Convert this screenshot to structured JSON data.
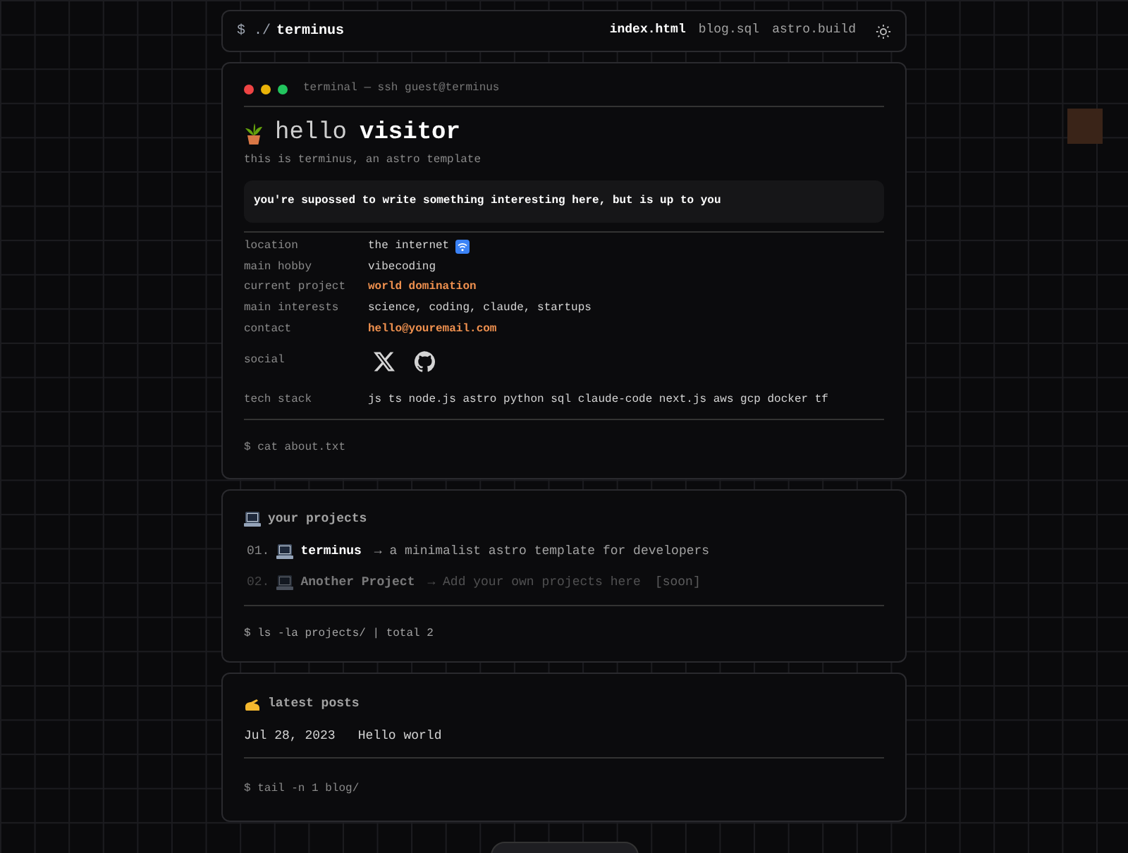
{
  "header": {
    "prompt": "$ ./",
    "title": "terminus",
    "nav": [
      {
        "label": "index.html",
        "selected": true
      },
      {
        "label": "blog.sql",
        "selected": false
      },
      {
        "label": "astro.build",
        "selected": false
      }
    ]
  },
  "terminal": {
    "title": "terminal — ssh guest@terminus",
    "greeting": "hello",
    "name": "visitor",
    "subtitle": "this is terminus, an astro template",
    "note": "you're supossed to write something interesting here, but is up to you",
    "rows": [
      {
        "label": "location",
        "kind": "wifi",
        "value": "the internet"
      },
      {
        "label": "main hobby",
        "kind": "plain",
        "value": "vibecoding"
      },
      {
        "label": "current project",
        "kind": "accent",
        "value": "world domination"
      },
      {
        "label": "main interests",
        "kind": "plain",
        "value": "science, coding, claude, startups"
      },
      {
        "label": "contact",
        "kind": "accent",
        "value": "hello@youremail.com"
      },
      {
        "label": "social",
        "kind": "social"
      },
      {
        "label": "tech stack",
        "kind": "plain",
        "value": "js ts node.js astro python sql claude-code next.js aws gcp docker tf"
      }
    ],
    "command": "$ cat about.txt"
  },
  "projects": {
    "title": "your projects",
    "items": [
      {
        "number": "01.",
        "name": "terminus",
        "description": "→ a minimalist astro template for developers",
        "disabled": false
      },
      {
        "number": "02.",
        "name": "Another Project",
        "description": "→ Add your own projects here",
        "tag": "[soon]",
        "disabled": true
      }
    ],
    "command": "$ ls -la projects/ | total 2"
  },
  "posts": {
    "title": "latest posts",
    "items": [
      {
        "date": "Jul 28, 2023",
        "title": "Hello world"
      }
    ],
    "command": "$ tail -n 1 blog/"
  }
}
